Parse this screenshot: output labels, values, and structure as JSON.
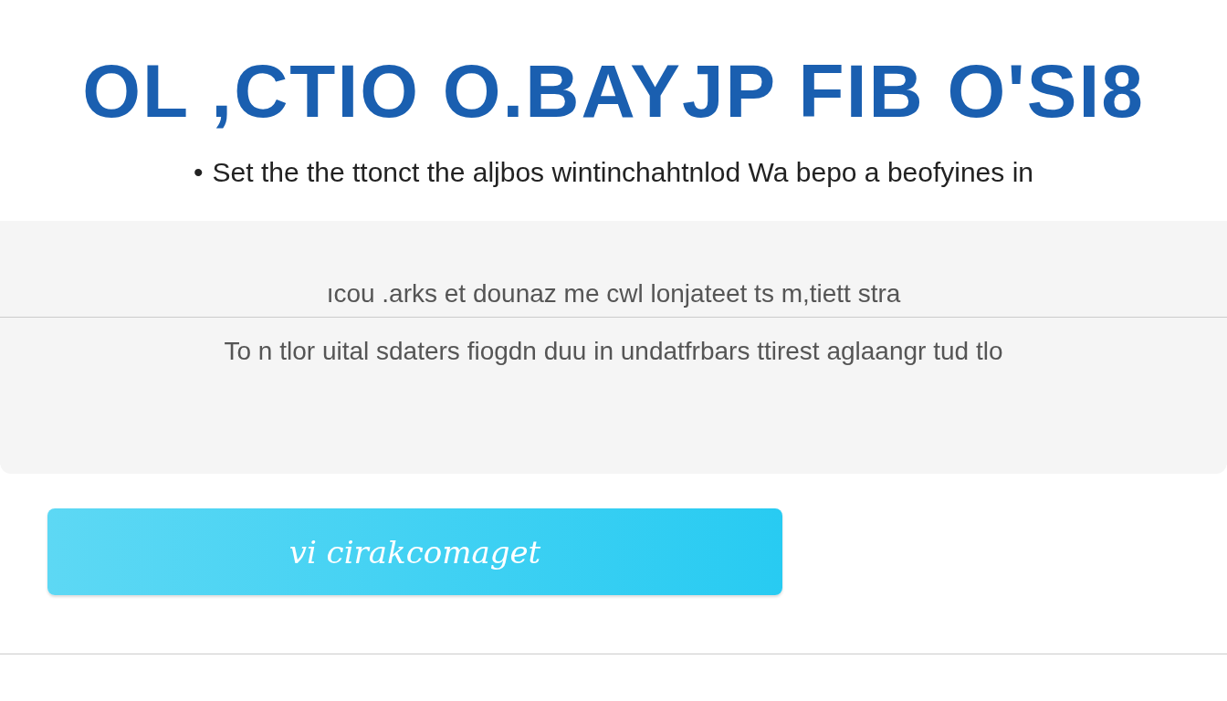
{
  "header": {
    "title": "OL ,CTIO O.BAYJP FIB O'SI8",
    "bullet": "•",
    "subtitle": "Set the the ttonct the aljbos wintinchahtnlod Wa bepo a beofyines in"
  },
  "panel": {
    "lines": [
      "ıcou .arks et dounaz me cwl lonjateet ts m,tiett stra",
      "To n tlor uital sdaters fiogdn duu in undatfrbars ttirest aglaangr tud tlo"
    ]
  },
  "button": {
    "label": "vi cirakcomaget"
  }
}
